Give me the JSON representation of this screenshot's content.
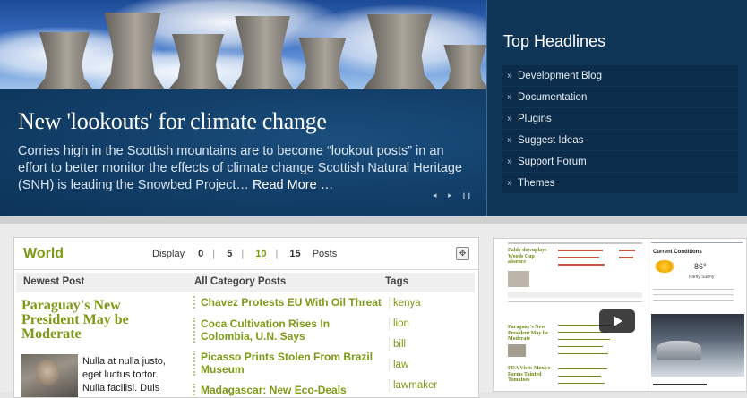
{
  "hero": {
    "title": "New 'lookouts' for climate change",
    "summary": "Corries high in the Scottish mountains are to become “lookout posts” in an effort to better monitor the effects of climate change Scottish Natural Heritage (SNH) is leading the Snowbed Project… ",
    "read_more": "Read More …",
    "controls": {
      "prev": "◂",
      "next": "▸",
      "pause": "❙❙"
    }
  },
  "top_headlines": {
    "title": "Top Headlines",
    "bullet": "»",
    "items": [
      "Development Blog",
      "Documentation",
      "Plugins",
      "Suggest Ideas",
      "Support Forum",
      "Themes"
    ]
  },
  "world": {
    "title": "World",
    "display_label": "Display",
    "options": [
      "0",
      "5",
      "10",
      "15"
    ],
    "selected": "10",
    "posts_label": "Posts",
    "columns": {
      "newest": "Newest Post",
      "category": "All Category Posts",
      "tags": "Tags"
    },
    "newest_post": {
      "title": "Paraguay's New President May be Moderate",
      "excerpt": "Nulla at nulla justo, eget luctus tortor. Nulla facilisi. Duis"
    },
    "category_posts": [
      "Chavez Protests EU With Oil Threat",
      "Coca Cultivation Rises In Colombia, U.N. Says",
      "Picasso Prints Stolen From Brazil Museum",
      "Madagascar: New Eco-Deals Protect"
    ],
    "tags": [
      "kenya",
      "lion",
      "bill",
      "law",
      "lawmaker"
    ]
  },
  "video": {
    "headline_a": "Faldo downplays Woods Cup absence",
    "headline_b": "Paraguay's New President May be Moderate",
    "headline_c": "FDA Visits Mexico Farms Tainted Tomatoes",
    "weather": {
      "label": "Current Conditions",
      "temp": "86°",
      "desc": "Partly Sunny"
    }
  },
  "colors": {
    "accent_green": "#7d9a16",
    "hero_blue": "#0f3556"
  }
}
